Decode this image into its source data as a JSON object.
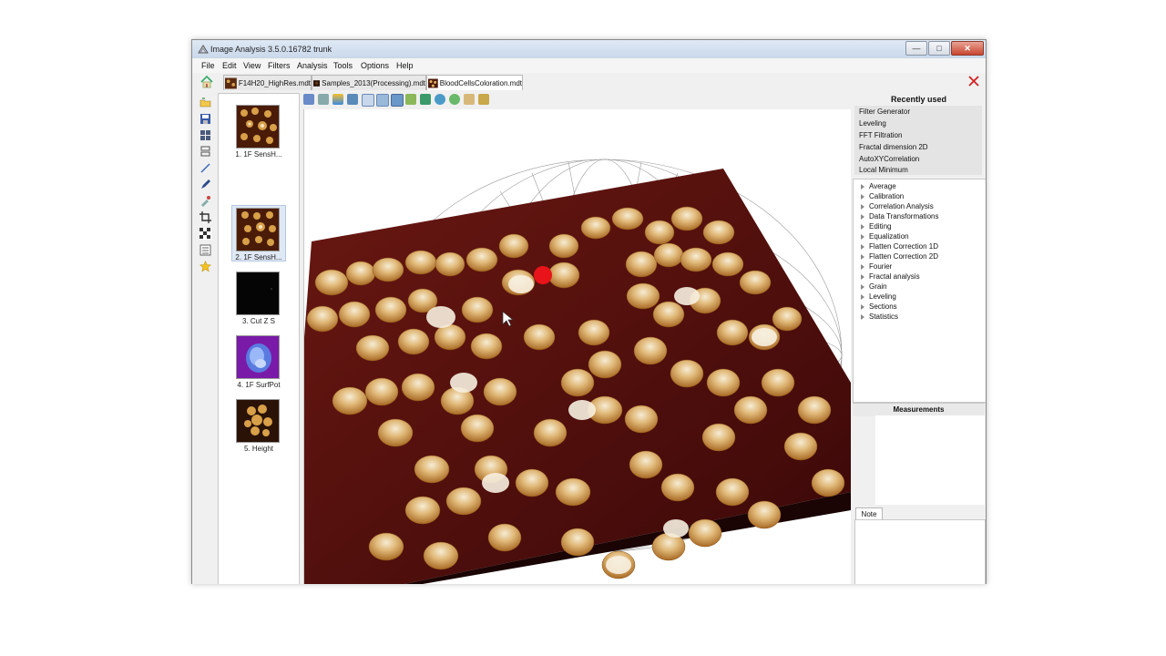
{
  "window": {
    "title": "Image Analysis 3.5.0.16782  trunk"
  },
  "menu": [
    "File",
    "Edit",
    "View",
    "Filters",
    "Analysis",
    "Tools",
    "Options",
    "Help"
  ],
  "tabs": [
    {
      "label": "F14H20_HighRes.mdt",
      "active": false
    },
    {
      "label": "Samples_2013(Processing).mdt",
      "active": false
    },
    {
      "label": "BloodCellsColoration.mdt",
      "active": true
    }
  ],
  "left_tools": [
    "open-icon",
    "save-icon",
    "grid-icon",
    "layers-icon",
    "line-icon",
    "pen-icon",
    "eyedropper-icon",
    "crop-icon",
    "checker-icon",
    "list-icon",
    "star-icon"
  ],
  "thumbnails": [
    {
      "label": "1. 1F SensH...",
      "kind": "brown-dots"
    },
    {
      "label": "2. 1F SensH...",
      "kind": "brown-dots",
      "selected": true
    },
    {
      "label": "3. Cut Z S",
      "kind": "black"
    },
    {
      "label": "4. 1F SurfPot",
      "kind": "purple-blue"
    },
    {
      "label": "5. Height",
      "kind": "dark-cells"
    }
  ],
  "view_toolbar": [
    "palette-icon",
    "axes-icon",
    "colorbar-icon",
    "camera-icon",
    "pointer-icon",
    "rotate-icon",
    "light-icon",
    "flat-icon",
    "tree-icon",
    "sphere-icon",
    "globe-icon",
    "cube-icon",
    "export-icon",
    "settings-icon"
  ],
  "right_panel": {
    "recently_used_title": "Recently used",
    "recently_used": [
      "Filter Generator",
      "Leveling",
      "FFT Filtration",
      "Fractal dimension 2D",
      "AutoXYCorrelation",
      "Local Minimum"
    ],
    "tree": [
      "Average",
      "Calibration",
      "Correlation Analysis",
      "Data Transformations",
      "Editing",
      "Equalization",
      "Flatten Correction 1D",
      "Flatten Correction 2D",
      "Fourier",
      "Fractal analysis",
      "Grain",
      "Leveling",
      "Sections",
      "Statistics"
    ],
    "measurements_title": "Measurements",
    "note_tab": "Note"
  },
  "colors": {
    "surface_base": "#5a1010",
    "cell_top": "#f2e6cc",
    "cell_side": "#b97a2e",
    "marker": "#e8141a"
  }
}
